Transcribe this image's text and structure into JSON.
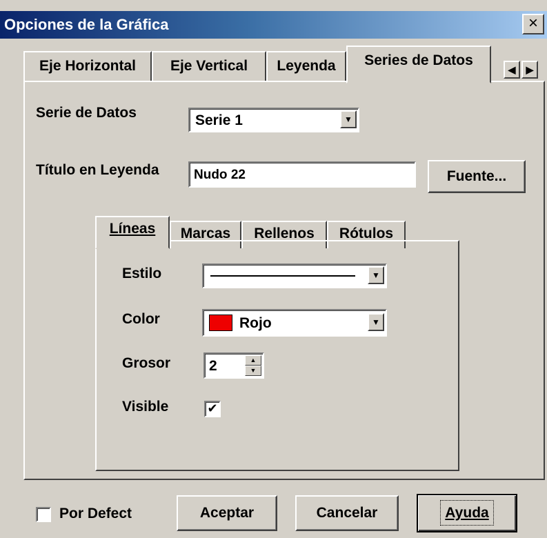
{
  "window": {
    "title": "Opciones de la Gráfica",
    "close_label": "×"
  },
  "tabs": [
    {
      "label": "Eje Horizontal"
    },
    {
      "label": "Eje Vertical"
    },
    {
      "label": "Leyenda"
    },
    {
      "label": "Series de Datos",
      "active": true
    }
  ],
  "tab_scroll": {
    "left": "◀",
    "right": "▶"
  },
  "series": {
    "label": "Serie de Datos",
    "selected": "Serie 1",
    "legend_title_label": "Título en Leyenda",
    "legend_title_value": "Nudo 22",
    "font_button": "Fuente..."
  },
  "inner_tabs": [
    {
      "label": "Líneas",
      "active": true
    },
    {
      "label": "Marcas"
    },
    {
      "label": "Rellenos"
    },
    {
      "label": "Rótulos"
    }
  ],
  "lines": {
    "style_label": "Estilo",
    "color_label": "Color",
    "color_value": "Rojo",
    "color_swatch": "#ee0000",
    "thickness_label": "Grosor",
    "thickness_value": "2",
    "visible_label": "Visible",
    "visible_checked": true
  },
  "footer": {
    "default_label": "Por Defect",
    "default_checked": false,
    "accept": "Aceptar",
    "cancel": "Cancelar",
    "help": "Ayuda"
  }
}
